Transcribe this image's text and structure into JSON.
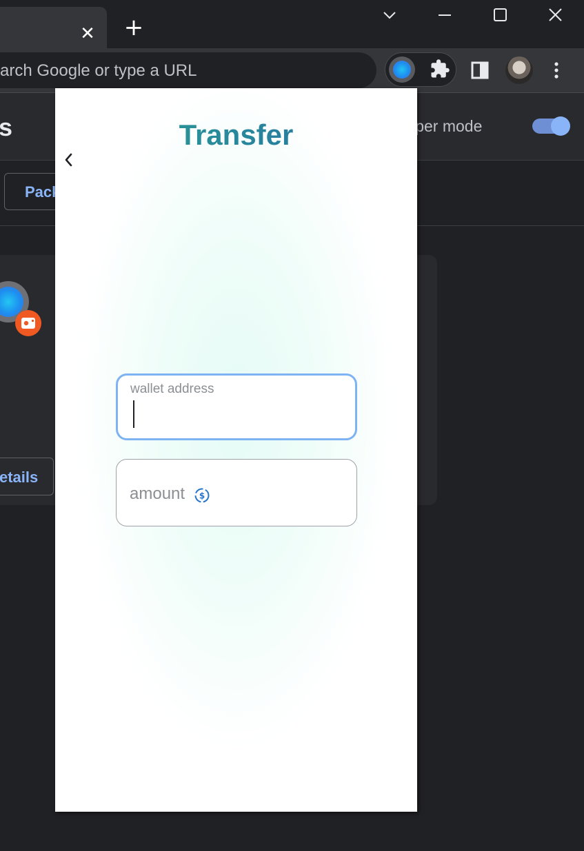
{
  "browser": {
    "tab_close_glyph": "✕",
    "new_tab_glyph": "+",
    "omnibox_placeholder": "arch Google or type a URL",
    "icons": [
      "tab-search-icon",
      "minimize-icon",
      "maximize-icon",
      "close-window-icon",
      "extension-orb-icon",
      "puzzle-icon",
      "side-panel-icon",
      "profile-avatar",
      "kebab-menu-icon"
    ]
  },
  "background_page": {
    "title": "s",
    "developer_mode_label": "veloper mode",
    "developer_mode_on": true,
    "pack_button_label": "Pack",
    "details_button_label": "etails"
  },
  "popup": {
    "title": "Transfer",
    "back_glyph": "‹",
    "wallet_field": {
      "label": "wallet address",
      "value": ""
    },
    "amount_field": {
      "placeholder": "amount",
      "icon": "usdc-icon"
    },
    "colors": {
      "title_start": "#2aa590",
      "title_end": "#276ba6",
      "focus_border": "#7db3f2"
    }
  }
}
